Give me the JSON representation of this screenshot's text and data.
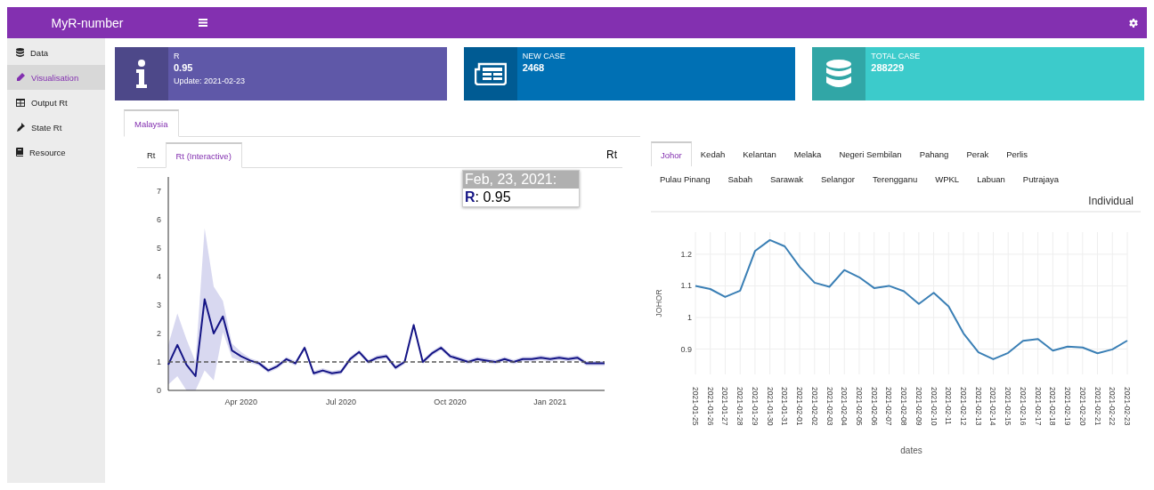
{
  "header": {
    "title": "MyR-number"
  },
  "sidebar": {
    "items": [
      {
        "label": "Data",
        "selected": false
      },
      {
        "label": "Visualisation",
        "selected": true
      },
      {
        "label": "Output Rt",
        "selected": false
      },
      {
        "label": "State Rt",
        "selected": false
      },
      {
        "label": "Resource",
        "selected": false
      }
    ]
  },
  "info_boxes": [
    {
      "kind": "info",
      "color": "#5f58a8",
      "label": "R",
      "value": "0.95",
      "subtitle": "Update: 2021-02-23"
    },
    {
      "kind": "news",
      "color": "#0070b4",
      "label": "NEW CASE",
      "value": "2468"
    },
    {
      "kind": "database",
      "color": "#3ccbcb",
      "label": "TOTAL CASE",
      "value": "288229"
    }
  ],
  "left_panel": {
    "tabs": [
      {
        "label": "Malaysia",
        "selected": true
      }
    ],
    "subtabs": [
      {
        "label": "Rt",
        "selected": false
      },
      {
        "label": "Rt (Interactive)",
        "selected": true
      }
    ],
    "heading": "Rt",
    "tooltip": {
      "title": "Feb, 23, 2021:",
      "text": "**R**: 0.95"
    },
    "chart_data": {
      "type": "line",
      "ylim": [
        0,
        7.5
      ],
      "yticks": [
        0,
        1,
        2,
        3,
        4,
        5,
        6,
        7
      ],
      "categories": [
        null,
        null,
        null,
        null,
        null,
        null,
        null,
        null,
        "Apr 2020",
        null,
        null,
        null,
        null,
        null,
        null,
        null,
        null,
        null,
        null,
        "Jul 2020",
        null,
        null,
        null,
        null,
        null,
        null,
        null,
        null,
        null,
        null,
        null,
        "Oct 2020",
        null,
        null,
        null,
        null,
        null,
        null,
        null,
        null,
        null,
        null,
        "Jan 2021",
        null,
        null,
        null,
        null,
        null,
        null
      ],
      "series": [
        {
          "color": "#141485",
          "values": [
            0.9,
            1.6,
            0.9,
            0.5,
            3.2,
            2.0,
            2.6,
            1.4,
            1.2,
            1.05,
            0.95,
            0.7,
            0.85,
            1.1,
            0.95,
            1.5,
            0.6,
            0.7,
            0.6,
            0.65,
            1.1,
            1.35,
            1.0,
            1.15,
            1.2,
            0.8,
            1.0,
            2.3,
            1.0,
            1.3,
            1.5,
            1.2,
            1.1,
            1.0,
            1.1,
            1.05,
            1.0,
            1.1,
            1.0,
            1.1,
            1.1,
            1.15,
            1.1,
            1.15,
            1.1,
            1.15,
            0.95,
            0.95,
            0.95
          ]
        }
      ],
      "ref_lines": [
        {
          "axis": "y",
          "value": 1
        }
      ]
    }
  },
  "right_panel": {
    "tab_rows": [
      [
        {
          "label": "Johor",
          "selected": true
        },
        {
          "label": "Kedah",
          "selected": false
        },
        {
          "label": "Kelantan",
          "selected": false
        },
        {
          "label": "Melaka",
          "selected": false
        },
        {
          "label": "Negeri Sembilan",
          "selected": false
        },
        {
          "label": "Pahang",
          "selected": false
        },
        {
          "label": "Perak",
          "selected": false
        },
        {
          "label": "Perlis",
          "selected": false
        }
      ],
      [
        {
          "label": "Pulau Pinang",
          "selected": false
        },
        {
          "label": "Sabah",
          "selected": false
        },
        {
          "label": "Sarawak",
          "selected": false
        },
        {
          "label": "Selangor",
          "selected": false
        },
        {
          "label": "Terengganu",
          "selected": false
        },
        {
          "label": "WPKL",
          "selected": false
        },
        {
          "label": "Labuan",
          "selected": false
        },
        {
          "label": "Putrajaya",
          "selected": false
        }
      ]
    ],
    "heading": "Individual",
    "chart_data": {
      "type": "line",
      "grid": true,
      "xlabel": "dates",
      "ylabel": "JOHOR",
      "ylim": [
        0.82,
        1.27
      ],
      "yticks": [
        0.9,
        1,
        1.1,
        1.2
      ],
      "categories": [
        "2021-01-25",
        "2021-01-26",
        "2021-01-27",
        "2021-01-28",
        "2021-01-29",
        "2021-01-30",
        "2021-01-31",
        "2021-02-01",
        "2021-02-02",
        "2021-02-03",
        "2021-02-04",
        "2021-02-05",
        "2021-02-06",
        "2021-02-07",
        "2021-02-08",
        "2021-02-09",
        "2021-02-10",
        "2021-02-11",
        "2021-02-12",
        "2021-02-13",
        "2021-02-14",
        "2021-02-15",
        "2021-02-16",
        "2021-02-17",
        "2021-02-18",
        "2021-02-19",
        "2021-02-20",
        "2021-02-21",
        "2021-02-22",
        "2021-02-23"
      ],
      "series": [
        {
          "color": "#3a7fb5",
          "values": [
            1.1,
            1.09,
            1.065,
            1.085,
            1.21,
            1.245,
            1.225,
            1.16,
            1.11,
            1.097,
            1.15,
            1.127,
            1.093,
            1.1,
            1.083,
            1.043,
            1.078,
            1.035,
            0.95,
            0.89,
            0.868,
            0.888,
            0.926,
            0.932,
            0.895,
            0.908,
            0.905,
            0.887,
            0.899,
            0.927
          ]
        }
      ]
    }
  }
}
